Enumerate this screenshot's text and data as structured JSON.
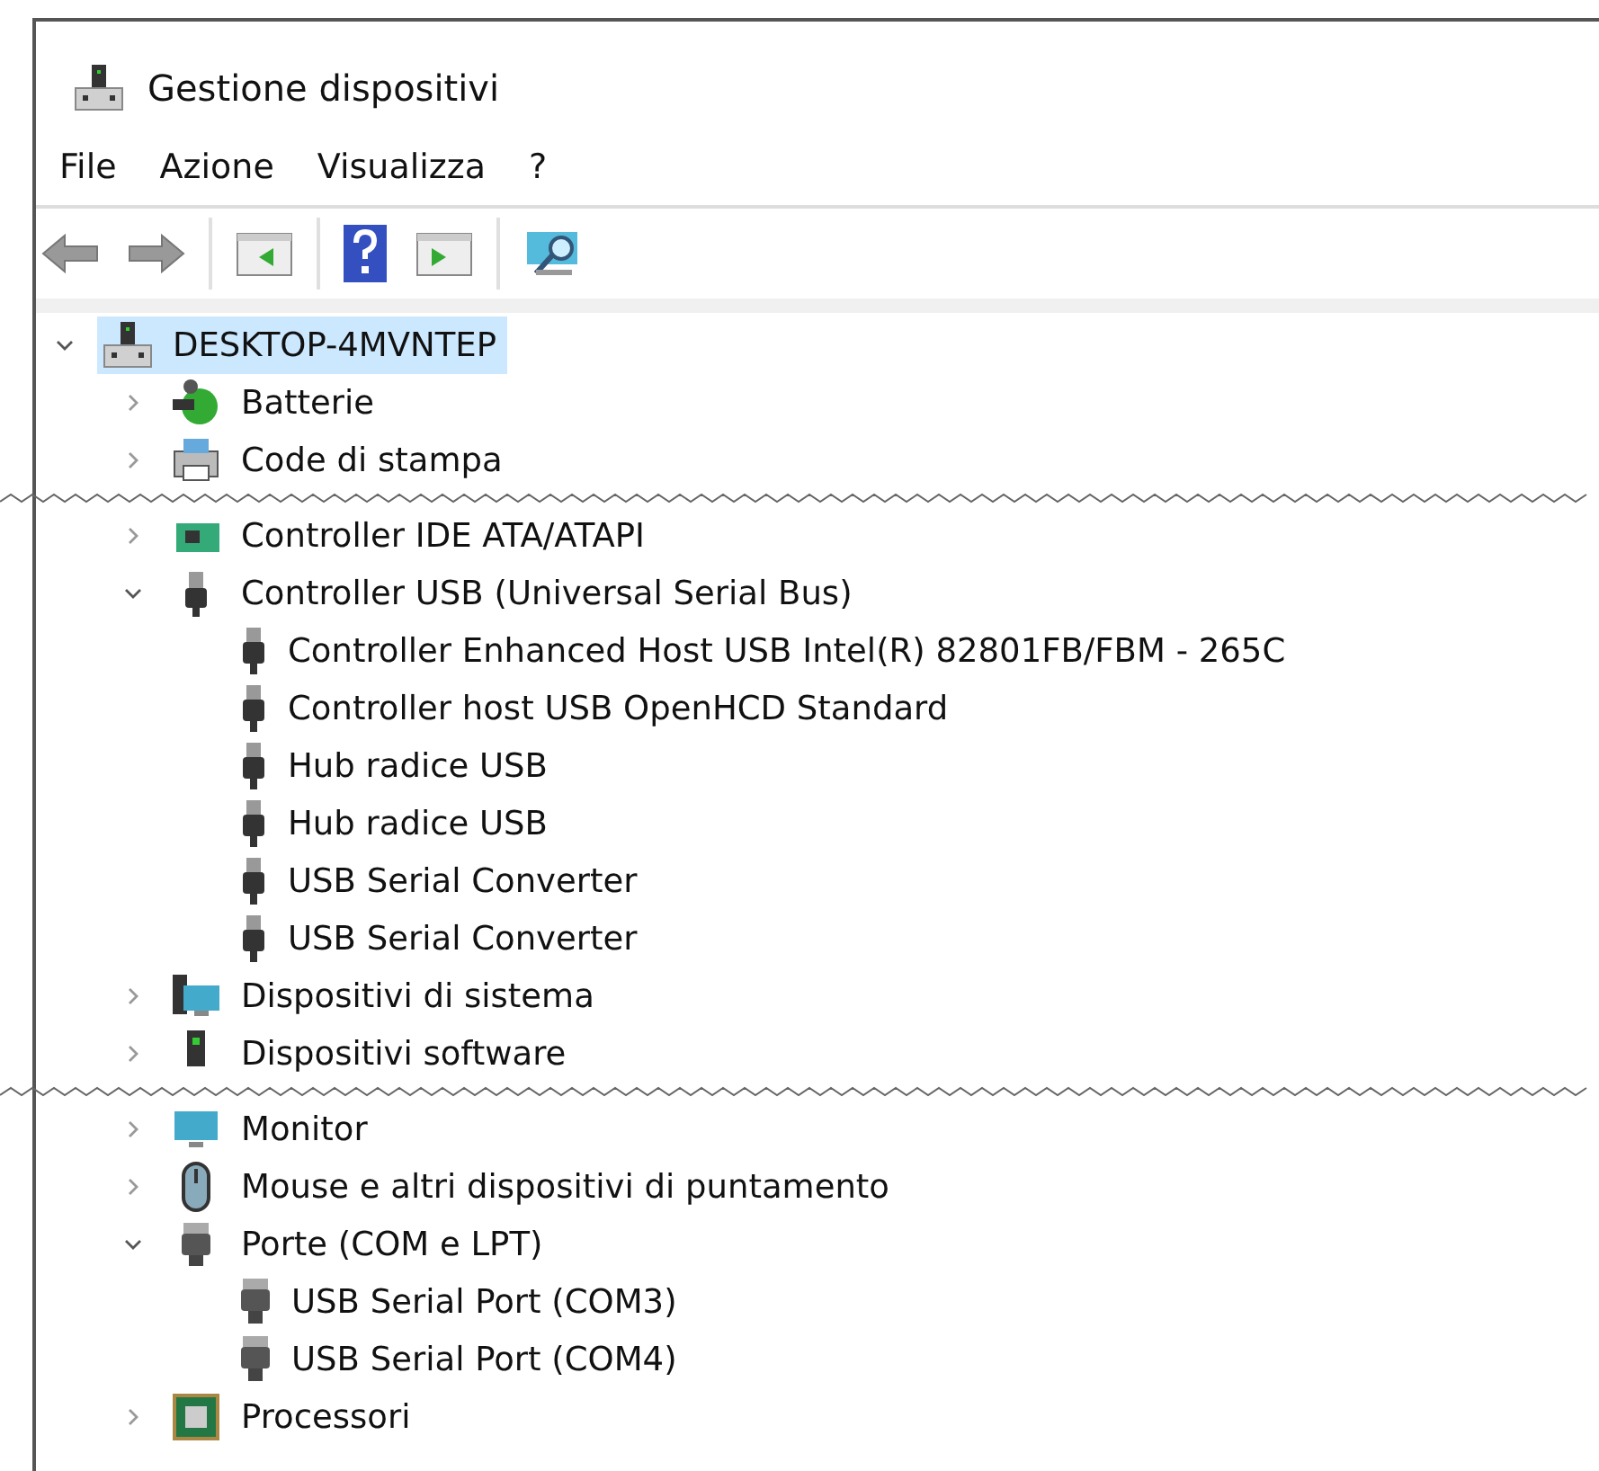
{
  "window": {
    "title": "Gestione dispositivi"
  },
  "menu": [
    "File",
    "Azione",
    "Visualizza",
    "?"
  ],
  "tree": {
    "label": "DESKTOP-4MVNTEP",
    "expanded": true,
    "selected": true,
    "children": [
      {
        "kind": "node",
        "label": "Batterie",
        "expanded": false,
        "selected": false
      },
      {
        "kind": "node",
        "label": "Code di stampa",
        "expanded": false,
        "selected": false
      },
      {
        "kind": "tear"
      },
      {
        "kind": "node",
        "label": "Controller IDE ATA/ATAPI",
        "expanded": false,
        "selected": false
      },
      {
        "kind": "node",
        "label": "Controller USB (Universal Serial Bus)",
        "expanded": true,
        "selected": false,
        "children": [
          {
            "label": "Controller Enhanced Host USB Intel(R) 82801FB/FBM - 265C",
            "selected": false
          },
          {
            "label": "Controller host USB OpenHCD Standard",
            "selected": false
          },
          {
            "label": "Hub radice USB",
            "selected": false
          },
          {
            "label": "Hub radice USB",
            "selected": false
          },
          {
            "label": "USB Serial Converter",
            "selected": false
          },
          {
            "label": "USB Serial Converter",
            "selected": false
          }
        ]
      },
      {
        "kind": "node",
        "label": "Dispositivi di sistema",
        "expanded": false,
        "selected": false
      },
      {
        "kind": "node",
        "label": "Dispositivi software",
        "expanded": false,
        "selected": false
      },
      {
        "kind": "tear"
      },
      {
        "kind": "node",
        "label": "Monitor",
        "expanded": false,
        "selected": false
      },
      {
        "kind": "node",
        "label": "Mouse e altri dispositivi di puntamento",
        "expanded": false,
        "selected": false
      },
      {
        "kind": "node",
        "label": "Porte (COM e LPT)",
        "expanded": true,
        "selected": false,
        "children": [
          {
            "label": "USB Serial Port (COM3)",
            "selected": false
          },
          {
            "label": "USB Serial Port (COM4)",
            "selected": false
          }
        ]
      },
      {
        "kind": "node",
        "label": "Processori",
        "expanded": false,
        "selected": false
      }
    ]
  }
}
